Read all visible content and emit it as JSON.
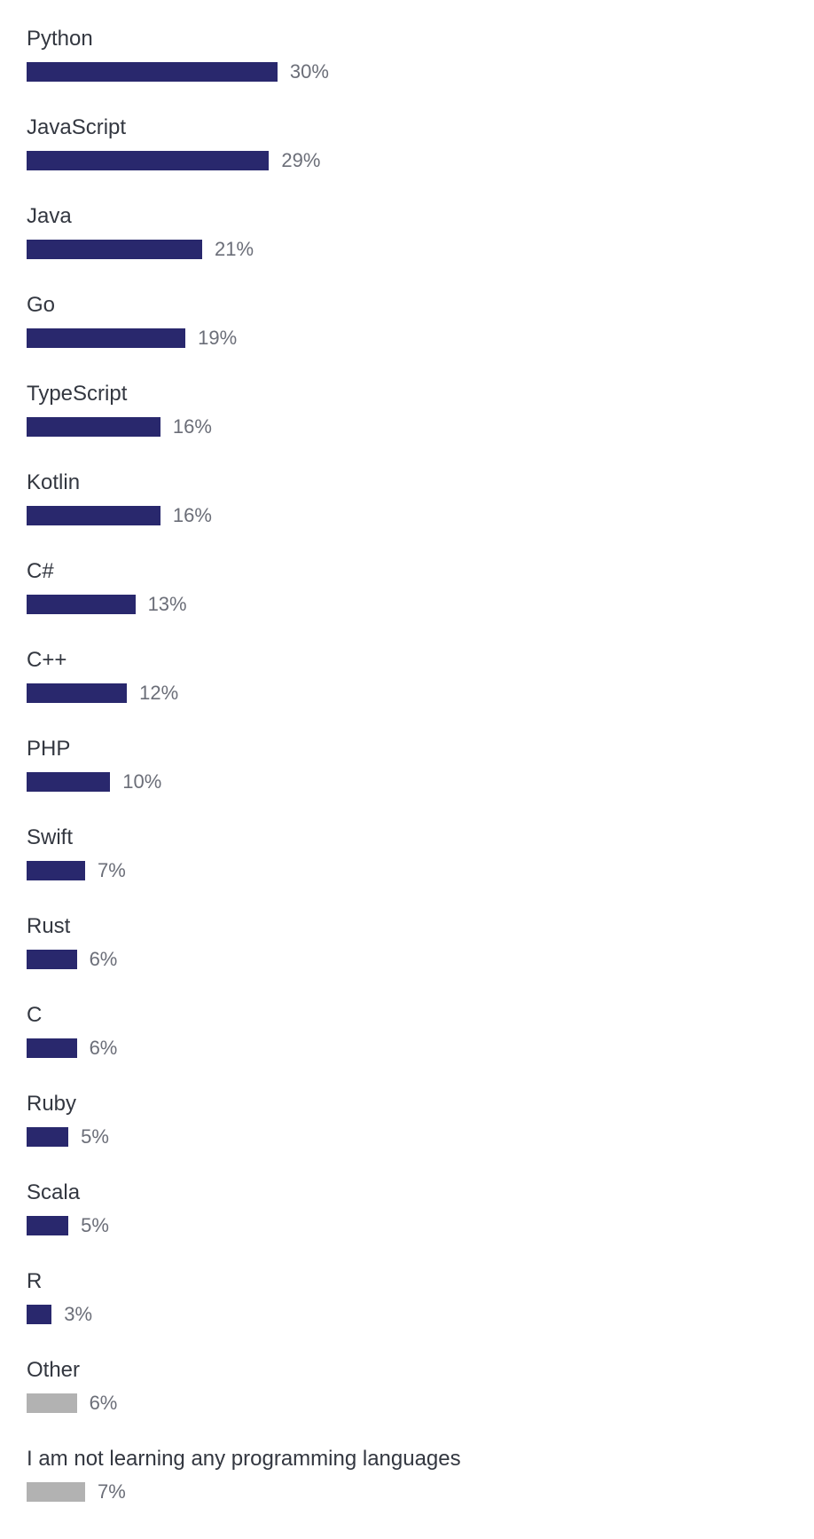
{
  "chart_data": {
    "type": "bar",
    "title": "",
    "xlabel": "",
    "ylabel": "",
    "items": [
      {
        "label": "Python",
        "value": 30,
        "display": "30%",
        "color": "primary"
      },
      {
        "label": "JavaScript",
        "value": 29,
        "display": "29%",
        "color": "primary"
      },
      {
        "label": "Java",
        "value": 21,
        "display": "21%",
        "color": "primary"
      },
      {
        "label": "Go",
        "value": 19,
        "display": "19%",
        "color": "primary"
      },
      {
        "label": "TypeScript",
        "value": 16,
        "display": "16%",
        "color": "primary"
      },
      {
        "label": "Kotlin",
        "value": 16,
        "display": "16%",
        "color": "primary"
      },
      {
        "label": "C#",
        "value": 13,
        "display": "13%",
        "color": "primary"
      },
      {
        "label": "C++",
        "value": 12,
        "display": "12%",
        "color": "primary"
      },
      {
        "label": "PHP",
        "value": 10,
        "display": "10%",
        "color": "primary"
      },
      {
        "label": "Swift",
        "value": 7,
        "display": "7%",
        "color": "primary"
      },
      {
        "label": "Rust",
        "value": 6,
        "display": "6%",
        "color": "primary"
      },
      {
        "label": "C",
        "value": 6,
        "display": "6%",
        "color": "primary"
      },
      {
        "label": "Ruby",
        "value": 5,
        "display": "5%",
        "color": "primary"
      },
      {
        "label": "Scala",
        "value": 5,
        "display": "5%",
        "color": "primary"
      },
      {
        "label": "R",
        "value": 3,
        "display": "3%",
        "color": "primary"
      },
      {
        "label": "Other",
        "value": 6,
        "display": "6%",
        "color": "gray"
      },
      {
        "label": "I am not learning any programming languages",
        "value": 7,
        "display": "7%",
        "color": "gray"
      }
    ],
    "colors": {
      "primary": "#29286d",
      "gray": "#b2b2b2"
    },
    "scale_max": 91
  }
}
